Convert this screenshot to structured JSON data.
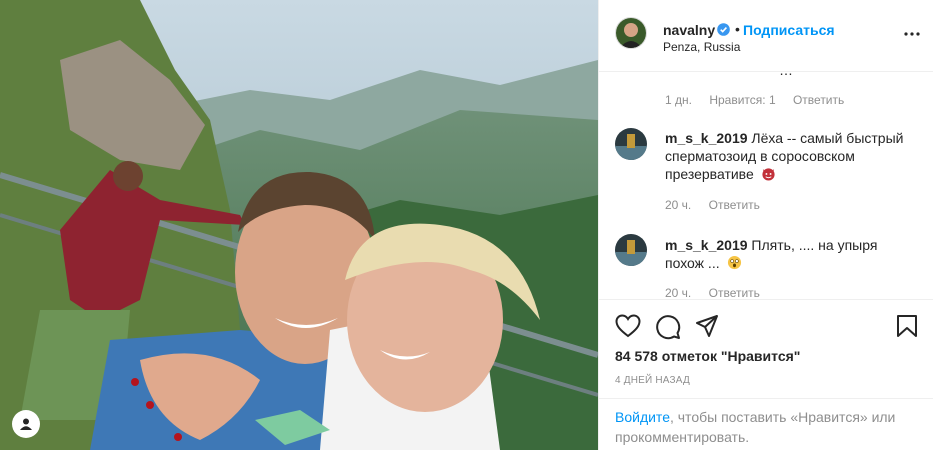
{
  "post": {
    "username": "navalny",
    "follow_label": "Подписаться",
    "dot": "•",
    "location": "Penza, Russia",
    "likes": "84 578 отметок \"Нравится\"",
    "date": "4 ДНЕЙ НАЗАД"
  },
  "comments": [
    {
      "partial_text": "…",
      "time": "1 дн.",
      "likes": "Нравится: 1",
      "reply": "Ответить"
    },
    {
      "user": "m_s_k_2019",
      "text": "Лёха -- самый быстрый сперматозоид в соросовском презервативе",
      "time": "20 ч.",
      "reply": "Ответить"
    },
    {
      "user": "m_s_k_2019",
      "text": "Плять, .... на упыря похож ...",
      "time": "20 ч.",
      "reply": "Ответить"
    }
  ],
  "login_prompt": {
    "link": "Войдите",
    "rest": ", чтобы поставить «Нравится» или прокомментировать."
  },
  "icons": [
    "verified-badge-icon",
    "more-options-icon",
    "heart-icon",
    "comment-icon",
    "share-icon",
    "bookmark-icon",
    "user-tag-icon"
  ],
  "colors": {
    "accent": "#0095f6",
    "text": "#262626",
    "muted": "#8e8e8e",
    "border": "#efefef"
  }
}
